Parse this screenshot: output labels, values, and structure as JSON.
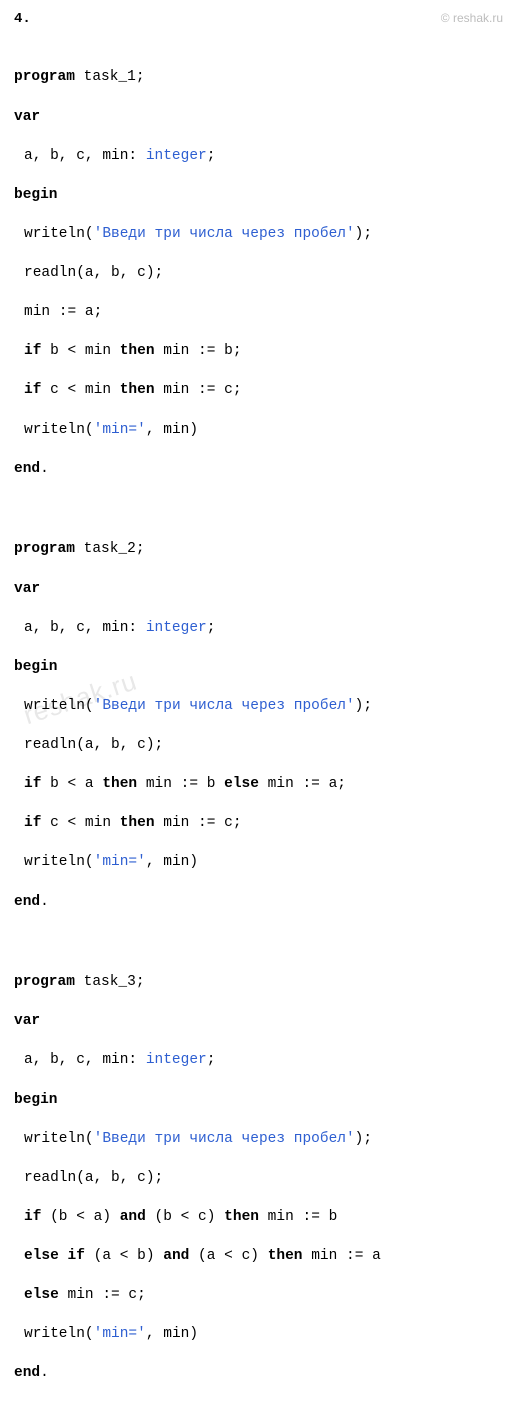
{
  "header_number": "4.",
  "site_watermark_top": "© reshak.ru",
  "site_watermark_diag": "reshak.ru",
  "programs": {
    "p1": {
      "kw_program": "program",
      "name": "task_1;",
      "kw_var": "var",
      "decl_pre": "a, b, c, min: ",
      "decl_type": "integer",
      "decl_post": ";",
      "kw_begin": "begin",
      "writeln1_pre": "writeln(",
      "writeln1_str": "'Введи три числа через пробел'",
      "writeln1_post": ");",
      "readln": "readln(a, b, c);",
      "assign_min": "min := a;",
      "if1_kw1": "if",
      "if1_cond": " b < min ",
      "if1_kw2": "then",
      "if1_body": " min := b;",
      "if2_kw1": "if",
      "if2_cond": " c < min ",
      "if2_kw2": "then",
      "if2_body": " min := c;",
      "writeln2_pre": "writeln(",
      "writeln2_str": "'min='",
      "writeln2_post": ", min)",
      "kw_end": "end",
      "end_dot": "."
    },
    "p2": {
      "kw_program": "program",
      "name": "task_2;",
      "kw_var": "var",
      "decl_pre": "a, b, c, min: ",
      "decl_type": "integer",
      "decl_post": ";",
      "kw_begin": "begin",
      "writeln1_pre": "writeln(",
      "writeln1_str": "'Введи три числа через пробел'",
      "writeln1_post": ");",
      "readln": "readln(a, b, c);",
      "if1_kw1": "if",
      "if1_cond": " b < a ",
      "if1_kw2": "then",
      "if1_body1": " min := b ",
      "if1_kw3": "else",
      "if1_body2": " min := a;",
      "if2_kw1": "if",
      "if2_cond": " c < min ",
      "if2_kw2": "then",
      "if2_body": " min := c;",
      "writeln2_pre": "writeln(",
      "writeln2_str": "'min='",
      "writeln2_post": ", min)",
      "kw_end": "end",
      "end_dot": "."
    },
    "p3": {
      "kw_program": "program",
      "name": "task_3;",
      "kw_var": "var",
      "decl_pre": "a, b, c, min: ",
      "decl_type": "integer",
      "decl_post": ";",
      "kw_begin": "begin",
      "writeln1_pre": "writeln(",
      "writeln1_str": "'Введи три числа через пробел'",
      "writeln1_post": ");",
      "readln": "readln(a, b, c);",
      "if1_kw1": "if",
      "if1_cond1": " (b < a) ",
      "if1_kw2": "and",
      "if1_cond2": " (b < c) ",
      "if1_kw3": "then",
      "if1_body": " min := b",
      "if2_kw1": "else",
      "if2_kw2": " if",
      "if2_cond1": " (a < b) ",
      "if2_kw3": "and",
      "if2_cond2": " (a < c) ",
      "if2_kw4": "then",
      "if2_body": " min := a",
      "if3_kw1": "else",
      "if3_body": " min := c;",
      "writeln2_pre": "writeln(",
      "writeln2_str": "'min='",
      "writeln2_post": ", min)",
      "kw_end": "end",
      "end_dot": "."
    }
  }
}
